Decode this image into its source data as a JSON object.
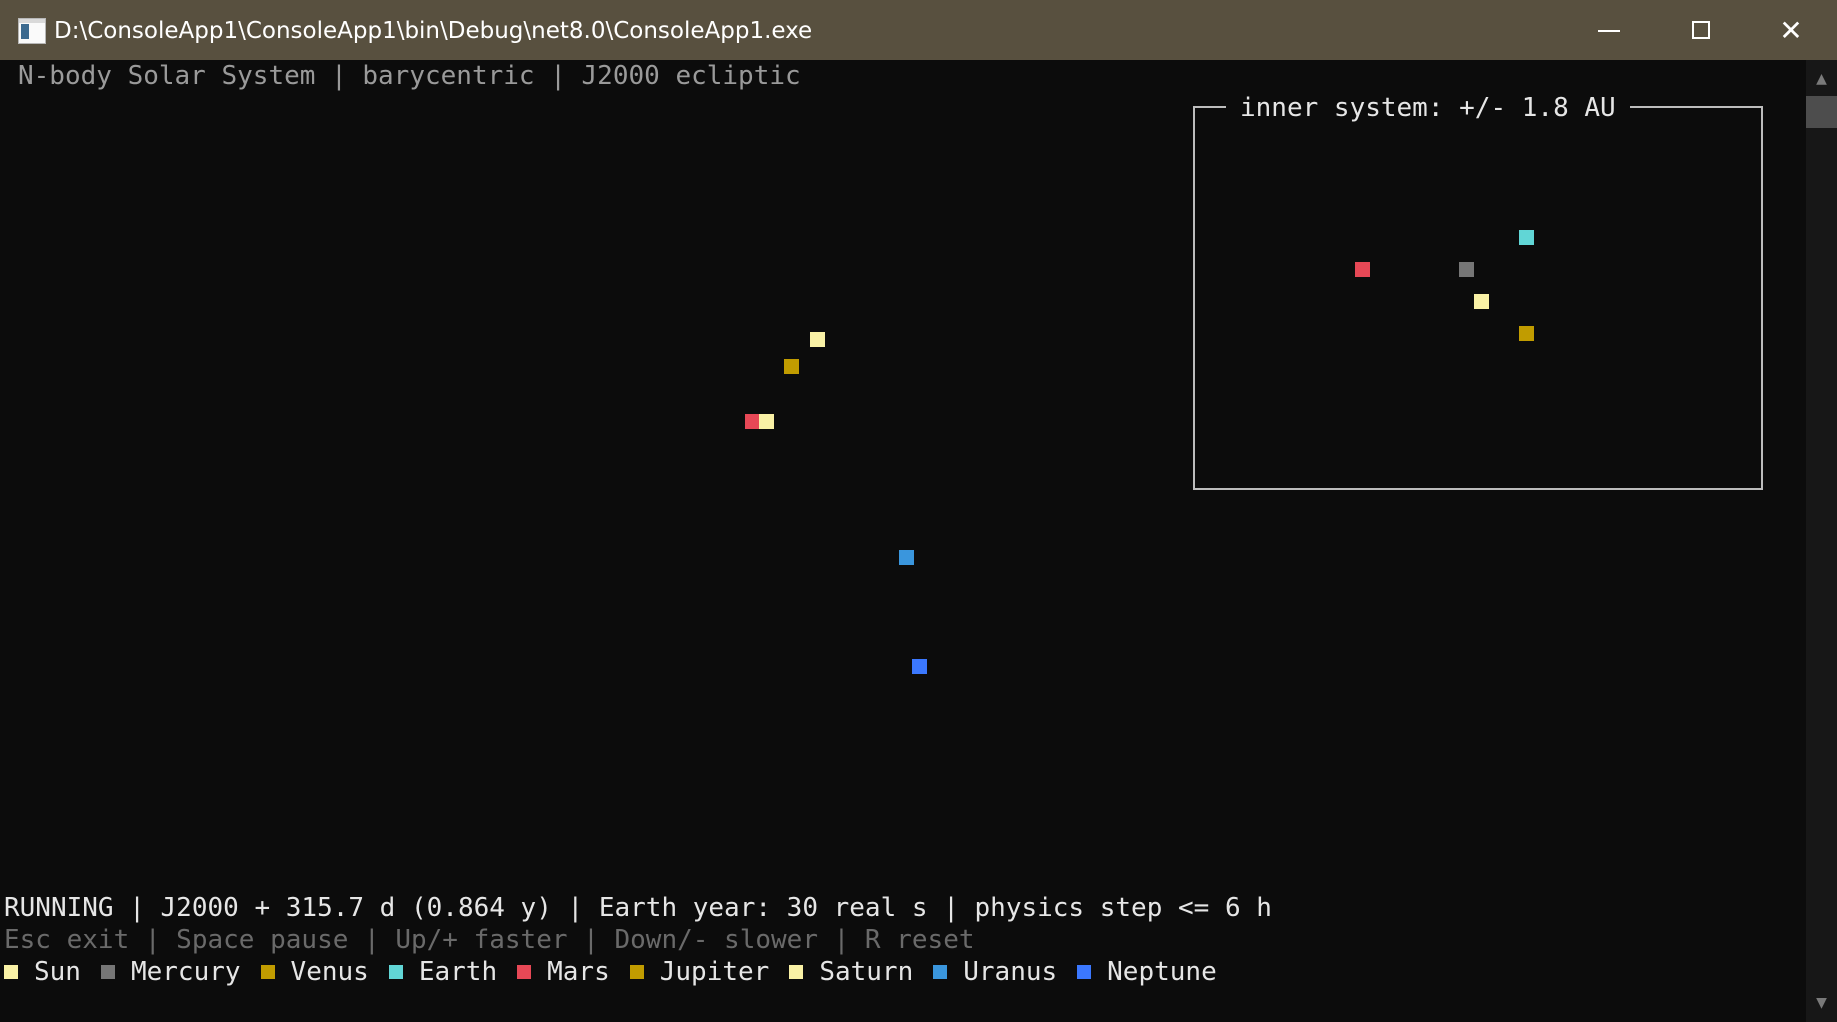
{
  "window": {
    "title": "D:\\ConsoleApp1\\ConsoleApp1\\bin\\Debug\\net8.0\\ConsoleApp1.exe",
    "titlebar_color": "#58503f"
  },
  "console": {
    "header": "N-body Solar System | barycentric | J2000 ecliptic",
    "inset_title": "inner system: +/- 1.8 AU",
    "status": "RUNNING | J2000 + 315.7 d (0.864 y) | Earth year: 30 real s | physics step <= 6 h",
    "keys": "Esc exit | Space pause | Up/+ faster | Down/- slower | R reset"
  },
  "legend": [
    {
      "label": "Sun",
      "color": "#f9f1a5"
    },
    {
      "label": "Mercury",
      "color": "#767676"
    },
    {
      "label": "Venus",
      "color": "#c19c00"
    },
    {
      "label": "Earth",
      "color": "#61d6d6"
    },
    {
      "label": "Mars",
      "color": "#e74856"
    },
    {
      "label": "Jupiter",
      "color": "#c19c00"
    },
    {
      "label": "Saturn",
      "color": "#f9f1a5"
    },
    {
      "label": "Uranus",
      "color": "#3a96dd"
    },
    {
      "label": "Neptune",
      "color": "#3b78ff"
    }
  ]
}
